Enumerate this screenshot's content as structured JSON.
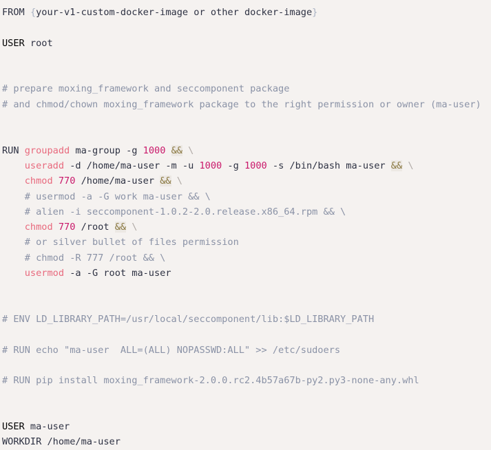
{
  "document": {
    "type": "dockerfile",
    "background_color": "#f5f2f0",
    "default_text_color": "#2d3142",
    "palette": {
      "instruction": "#2d3142",
      "user_keyword": "#8b2a6b",
      "comment": "#8a92a6",
      "command": "#e8697d",
      "number": "#c9186a",
      "operator": "#8a7840",
      "operator_background": "#ece8e4",
      "continuation": "#b0aaa6",
      "brace": "#a9b2c3"
    }
  },
  "lines": [
    {
      "index": 1,
      "text": "FROM {your-v1-custom-docker-image or other docker-image}",
      "tokens": [
        {
          "text": "FROM",
          "type": "instruction"
        },
        {
          "text": " ",
          "type": "plain"
        },
        {
          "text": "{",
          "type": "brace"
        },
        {
          "text": "your-v1-custom-docker-image or other docker-image",
          "type": "plain"
        },
        {
          "text": "}",
          "type": "brace"
        }
      ]
    },
    {
      "index": 2,
      "text": "",
      "tokens": []
    },
    {
      "index": 3,
      "text": "USER root",
      "tokens": [
        {
          "text": "USER",
          "type": "user_keyword"
        },
        {
          "text": " root",
          "type": "plain"
        }
      ]
    },
    {
      "index": 4,
      "text": "",
      "tokens": []
    },
    {
      "index": 5,
      "text": "",
      "tokens": []
    },
    {
      "index": 6,
      "text": "# prepare moxing_framework and seccomponent package",
      "tokens": [
        {
          "text": "# prepare moxing_framework and seccomponent package",
          "type": "comment"
        }
      ]
    },
    {
      "index": 7,
      "text": "# and chmod/chown moxing_framework package to the right permission or owner (ma-user)",
      "tokens": [
        {
          "text": "# and chmod/chown moxing_framework package to the right permission or owner (ma-user)",
          "type": "comment"
        }
      ]
    },
    {
      "index": 8,
      "text": "",
      "tokens": []
    },
    {
      "index": 9,
      "text": "",
      "tokens": []
    },
    {
      "index": 10,
      "text": "RUN groupadd ma-group -g 1000 && \\",
      "tokens": [
        {
          "text": "RUN",
          "type": "instruction"
        },
        {
          "text": " ",
          "type": "plain"
        },
        {
          "text": "groupadd",
          "type": "command"
        },
        {
          "text": " ma-group -g ",
          "type": "plain"
        },
        {
          "text": "1000",
          "type": "number"
        },
        {
          "text": " ",
          "type": "plain"
        },
        {
          "text": "&&",
          "type": "operator"
        },
        {
          "text": " ",
          "type": "plain"
        },
        {
          "text": "\\",
          "type": "continuation"
        }
      ]
    },
    {
      "index": 11,
      "text": "    useradd -d /home/ma-user -m -u 1000 -g 1000 -s /bin/bash ma-user && \\",
      "tokens": [
        {
          "text": "    ",
          "type": "plain"
        },
        {
          "text": "useradd",
          "type": "command"
        },
        {
          "text": " -d /home/ma-user -m -u ",
          "type": "plain"
        },
        {
          "text": "1000",
          "type": "number"
        },
        {
          "text": " -g ",
          "type": "plain"
        },
        {
          "text": "1000",
          "type": "number"
        },
        {
          "text": " -s /bin/bash ma-user ",
          "type": "plain"
        },
        {
          "text": "&&",
          "type": "operator"
        },
        {
          "text": " ",
          "type": "plain"
        },
        {
          "text": "\\",
          "type": "continuation"
        }
      ]
    },
    {
      "index": 12,
      "text": "    chmod 770 /home/ma-user && \\",
      "tokens": [
        {
          "text": "    ",
          "type": "plain"
        },
        {
          "text": "chmod",
          "type": "command"
        },
        {
          "text": " ",
          "type": "plain"
        },
        {
          "text": "770",
          "type": "number"
        },
        {
          "text": " /home/ma-user ",
          "type": "plain"
        },
        {
          "text": "&&",
          "type": "operator"
        },
        {
          "text": " ",
          "type": "plain"
        },
        {
          "text": "\\",
          "type": "continuation"
        }
      ]
    },
    {
      "index": 13,
      "text": "    # usermod -a -G work ma-user && \\",
      "tokens": [
        {
          "text": "    ",
          "type": "plain"
        },
        {
          "text": "# usermod -a -G work ma-user && \\",
          "type": "comment"
        }
      ]
    },
    {
      "index": 14,
      "text": "    # alien -i seccomponent-1.0.2-2.0.release.x86_64.rpm && \\",
      "tokens": [
        {
          "text": "    ",
          "type": "plain"
        },
        {
          "text": "# alien -i seccomponent-1.0.2-2.0.release.x86_64.rpm && \\",
          "type": "comment"
        }
      ]
    },
    {
      "index": 15,
      "text": "    chmod 770 /root && \\",
      "tokens": [
        {
          "text": "    ",
          "type": "plain"
        },
        {
          "text": "chmod",
          "type": "command"
        },
        {
          "text": " ",
          "type": "plain"
        },
        {
          "text": "770",
          "type": "number"
        },
        {
          "text": " /root ",
          "type": "plain"
        },
        {
          "text": "&&",
          "type": "operator"
        },
        {
          "text": " ",
          "type": "plain"
        },
        {
          "text": "\\",
          "type": "continuation"
        }
      ]
    },
    {
      "index": 16,
      "text": "    # or silver bullet of files permission",
      "tokens": [
        {
          "text": "    ",
          "type": "plain"
        },
        {
          "text": "# or silver bullet of files permission",
          "type": "comment"
        }
      ]
    },
    {
      "index": 17,
      "text": "    # chmod -R 777 /root && \\",
      "tokens": [
        {
          "text": "    ",
          "type": "plain"
        },
        {
          "text": "# chmod -R 777 /root && \\",
          "type": "comment"
        }
      ]
    },
    {
      "index": 18,
      "text": "    usermod -a -G root ma-user",
      "tokens": [
        {
          "text": "    ",
          "type": "plain"
        },
        {
          "text": "usermod",
          "type": "command"
        },
        {
          "text": " -a -G root ma-user",
          "type": "plain"
        }
      ]
    },
    {
      "index": 19,
      "text": "",
      "tokens": []
    },
    {
      "index": 20,
      "text": "",
      "tokens": []
    },
    {
      "index": 21,
      "text": "# ENV LD_LIBRARY_PATH=/usr/local/seccomponent/lib:$LD_LIBRARY_PATH",
      "tokens": [
        {
          "text": "# ENV LD_LIBRARY_PATH=/usr/local/seccomponent/lib:$LD_LIBRARY_PATH",
          "type": "comment"
        }
      ]
    },
    {
      "index": 22,
      "text": "",
      "tokens": []
    },
    {
      "index": 23,
      "text": "# RUN echo \"ma-user  ALL=(ALL) NOPASSWD:ALL\" >> /etc/sudoers",
      "tokens": [
        {
          "text": "# RUN echo \"ma-user  ALL=(ALL) NOPASSWD:ALL\" >> /etc/sudoers",
          "type": "comment"
        }
      ]
    },
    {
      "index": 24,
      "text": "",
      "tokens": []
    },
    {
      "index": 25,
      "text": "# RUN pip install moxing_framework-2.0.0.rc2.4b57a67b-py2.py3-none-any.whl",
      "tokens": [
        {
          "text": "# RUN pip install moxing_framework-2.0.0.rc2.4b57a67b-py2.py3-none-any.whl",
          "type": "comment"
        }
      ]
    },
    {
      "index": 26,
      "text": "",
      "tokens": []
    },
    {
      "index": 27,
      "text": "",
      "tokens": []
    },
    {
      "index": 28,
      "text": "USER ma-user",
      "tokens": [
        {
          "text": "USER",
          "type": "user_keyword"
        },
        {
          "text": " ma-user",
          "type": "plain"
        }
      ]
    },
    {
      "index": 29,
      "text": "WORKDIR /home/ma-user",
      "tokens": [
        {
          "text": "WORKDIR",
          "type": "instruction"
        },
        {
          "text": " /home/ma-user",
          "type": "plain"
        }
      ]
    }
  ]
}
